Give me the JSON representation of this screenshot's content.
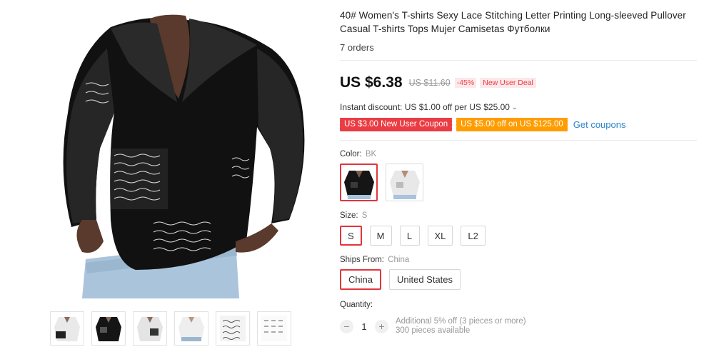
{
  "product": {
    "title": "40# Women's T-shirts Sexy Lace Stitching Letter Printing Long-sleeved Pullover Casual T-shirts Tops Mujer Camisetas Футболки",
    "orders": "7 orders"
  },
  "pricing": {
    "price": "US $6.38",
    "original_price": "US $11.60",
    "discount": "-45%",
    "deal_tag": "New User Deal",
    "instant_discount": "Instant discount: US $1.00 off per US $25.00"
  },
  "coupons": {
    "items": [
      "US $3.00 New User Coupon",
      "US $5.00 off on US $125.00"
    ],
    "get_label": "Get coupons"
  },
  "color": {
    "label": "Color:",
    "selected": "BK",
    "options": [
      "BK",
      "White"
    ]
  },
  "size": {
    "label": "Size:",
    "selected": "S",
    "options": [
      "S",
      "M",
      "L",
      "XL",
      "L2"
    ]
  },
  "ships_from": {
    "label": "Ships From:",
    "selected": "China",
    "options": [
      "China",
      "United States"
    ]
  },
  "quantity": {
    "label": "Quantity:",
    "value": "1",
    "minus": "−",
    "plus": "+",
    "note_line1": "Additional 5% off (3 pieces or more)",
    "note_line2": "300 pieces available"
  },
  "gallery": {
    "thumbnail_icons": [
      "white-top-icon",
      "black-top-icon",
      "white-top-icon",
      "white-top-icon",
      "script-print-icon",
      "script-print-icon"
    ]
  },
  "colors": {
    "accent": "#e3343c",
    "coupon_red": "#ea3c43",
    "coupon_orange": "#ff9c00",
    "link": "#2b85c9"
  }
}
